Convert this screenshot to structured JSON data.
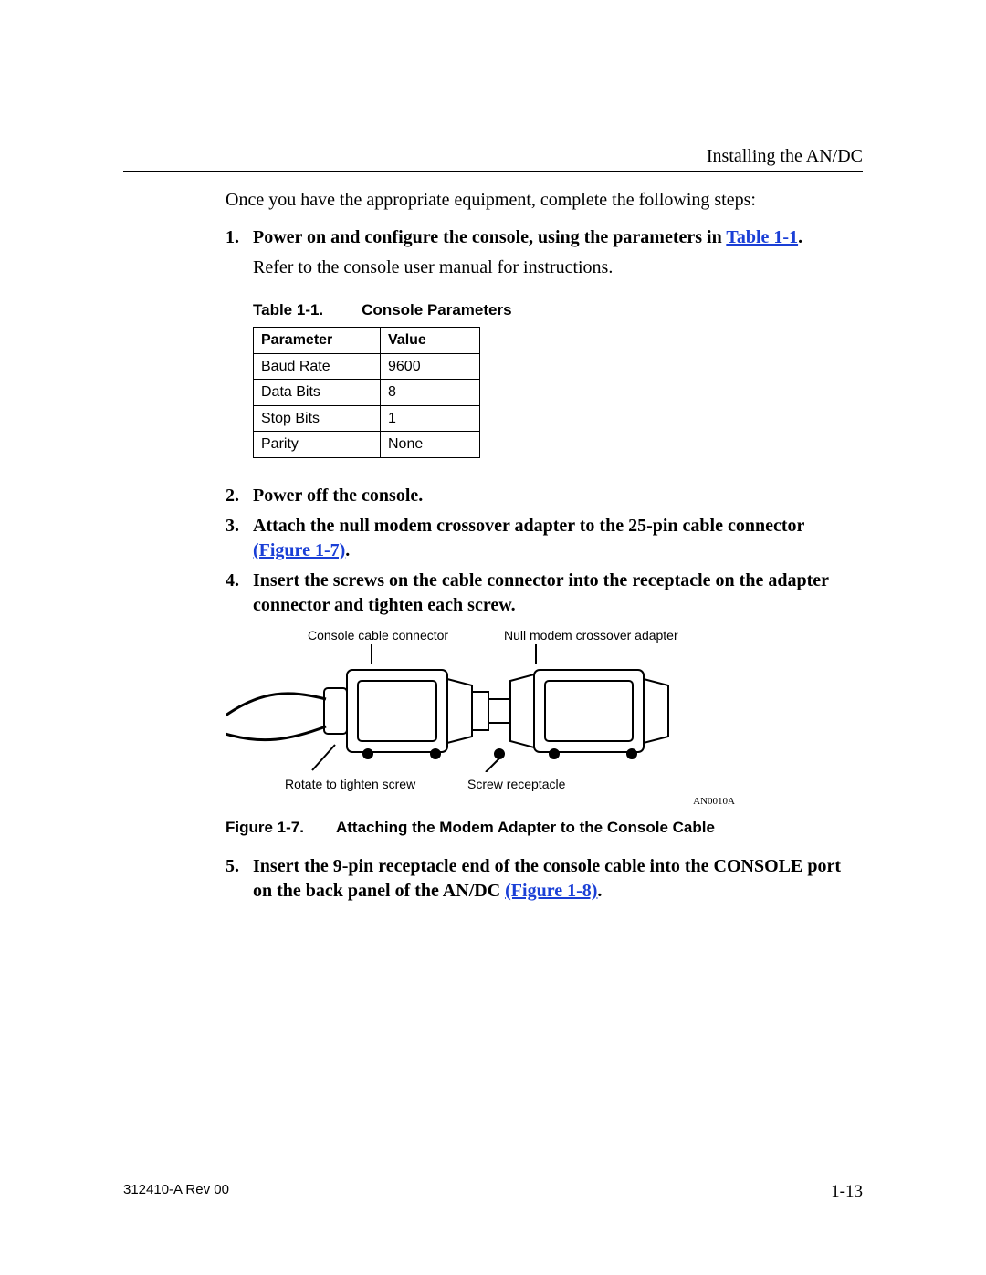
{
  "header": {
    "section": "Installing the AN/DC"
  },
  "intro": "Once you have the appropriate equipment, complete the following steps:",
  "steps": {
    "s1": {
      "num": "1.",
      "text_a": "Power on and configure the console, using the parameters in ",
      "link": "Table 1-1",
      "text_b": ".",
      "sub": "Refer to the console user manual for instructions."
    },
    "s2": {
      "num": "2.",
      "text": "Power off the console."
    },
    "s3": {
      "num": "3.",
      "text_a": "Attach the null modem crossover adapter to the 25-pin cable connector ",
      "link": "(Figure 1-7)",
      "text_b": "."
    },
    "s4": {
      "num": "4.",
      "text": "Insert the screws on the cable connector into the receptacle on the adapter connector and tighten each screw."
    },
    "s5": {
      "num": "5.",
      "text_a": "Insert the 9-pin receptacle end of the console cable into the CONSOLE port on the back panel of the AN/DC ",
      "link": "(Figure 1-8)",
      "text_b": "."
    }
  },
  "table": {
    "caption_a": "Table 1-1.",
    "caption_b": "Console Parameters",
    "headers": {
      "c1": "Parameter",
      "c2": "Value"
    },
    "rows": [
      {
        "c1": "Baud Rate",
        "c2": "9600"
      },
      {
        "c1": "Data Bits",
        "c2": "8"
      },
      {
        "c1": "Stop Bits",
        "c2": "1"
      },
      {
        "c1": "Parity",
        "c2": "None"
      }
    ]
  },
  "figure": {
    "top_label_1": "Console cable connector",
    "top_label_2": "Null modem crossover adapter",
    "bot_label_1": "Rotate to tighten screw",
    "bot_label_2": "Screw receptacle",
    "id": "AN0010A",
    "caption_a": "Figure 1-7.",
    "caption_b": "Attaching the Modem Adapter to the Console Cable"
  },
  "footer": {
    "doc": "312410-A Rev 00",
    "page": "1-13"
  }
}
